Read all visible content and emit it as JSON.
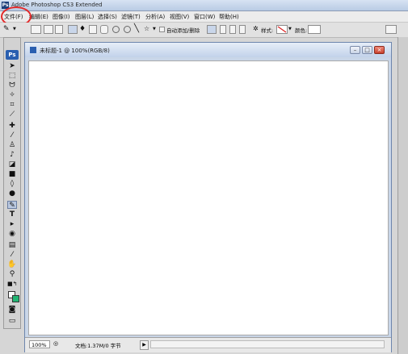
{
  "app": {
    "title": "Adobe Photoshop CS3 Extended",
    "logo": "Ps"
  },
  "menu": [
    {
      "label": "文件(F)"
    },
    {
      "label": "编辑(E)"
    },
    {
      "label": "图像(I)"
    },
    {
      "label": "图层(L)"
    },
    {
      "label": "选择(S)"
    },
    {
      "label": "滤镜(T)"
    },
    {
      "label": "分析(A)"
    },
    {
      "label": "视图(V)"
    },
    {
      "label": "窗口(W)"
    },
    {
      "label": "帮助(H)"
    }
  ],
  "options_bar": {
    "auto_add_delete": "自动添加/删除",
    "style_label": "样式:",
    "color_label": "颜色:"
  },
  "document": {
    "title": "未标题-1 @ 100%(RGB/8)",
    "zoom": "100%",
    "doc_info": "文档:1.37M/0 字节"
  },
  "toolbox": {
    "logo": "Ps"
  },
  "colors": {
    "highlight_circle": "#e32a2a",
    "canvas": "#ffffff",
    "quick_mask": "#22b573"
  }
}
